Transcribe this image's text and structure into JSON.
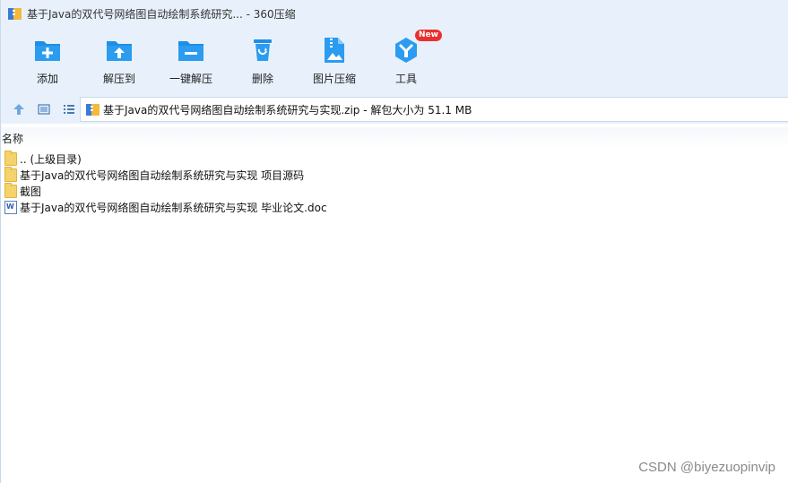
{
  "window": {
    "title": "基于Java的双代号网络图自动绘制系统研究... - 360压缩"
  },
  "toolbar": {
    "items": [
      {
        "label": "添加",
        "icon": "add-folder-icon"
      },
      {
        "label": "解压到",
        "icon": "extract-to-icon"
      },
      {
        "label": "一键解压",
        "icon": "one-click-extract-icon"
      },
      {
        "label": "删除",
        "icon": "delete-icon"
      },
      {
        "label": "图片压缩",
        "icon": "image-compress-icon"
      },
      {
        "label": "工具",
        "icon": "tools-icon",
        "badge": "New"
      }
    ]
  },
  "addressbar": {
    "path": "基于Java的双代号网络图自动绘制系统研究与实现.zip - 解包大小为 51.1 MB"
  },
  "columns": {
    "name": "名称"
  },
  "files": [
    {
      "name": ".. (上级目录)",
      "type": "folder"
    },
    {
      "name": "基于Java的双代号网络图自动绘制系统研究与实现 项目源码",
      "type": "folder"
    },
    {
      "name": "截图",
      "type": "folder"
    },
    {
      "name": "基于Java的双代号网络图自动绘制系统研究与实现 毕业论文.doc",
      "type": "doc"
    }
  ],
  "watermark": "CSDN @biyezuopinvip",
  "colors": {
    "accent": "#1e8fe6",
    "toolbar_bg": "#e8f1fb",
    "badge": "#e8312f"
  }
}
